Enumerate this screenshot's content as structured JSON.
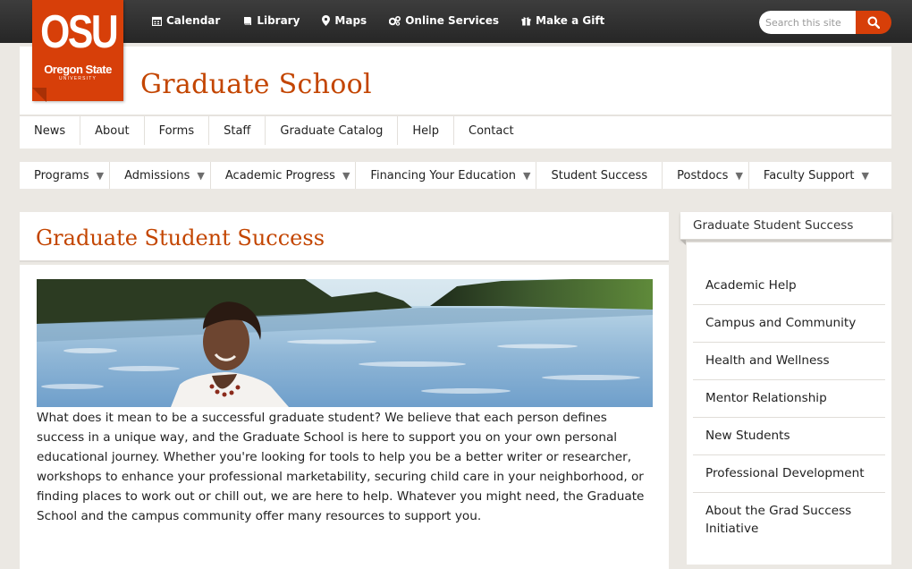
{
  "logo": {
    "mark": "OSU",
    "name": "Oregon State",
    "sub": "UNIVERSITY"
  },
  "topnav": [
    {
      "label": "Calendar",
      "icon": "calendar-icon"
    },
    {
      "label": "Library",
      "icon": "book-icon"
    },
    {
      "label": "Maps",
      "icon": "map-marker-icon"
    },
    {
      "label": "Online Services",
      "icon": "gears-icon"
    },
    {
      "label": "Make a Gift",
      "icon": "gift-icon"
    }
  ],
  "search": {
    "placeholder": "Search this site",
    "value": ""
  },
  "site": {
    "title": "Graduate School"
  },
  "menu_primary": [
    "News",
    "About",
    "Forms",
    "Staff",
    "Graduate Catalog",
    "Help",
    "Contact"
  ],
  "menu_secondary": [
    {
      "label": "Programs",
      "dropdown": true
    },
    {
      "label": "Admissions",
      "dropdown": true
    },
    {
      "label": "Academic Progress",
      "dropdown": true
    },
    {
      "label": "Financing Your Education",
      "dropdown": true
    },
    {
      "label": "Student Success",
      "dropdown": false
    },
    {
      "label": "Postdocs",
      "dropdown": true
    },
    {
      "label": "Faculty Support",
      "dropdown": true
    }
  ],
  "dropdown_glyph": "▼",
  "page": {
    "title": "Graduate Student Success",
    "intro": "What does it mean to be a successful graduate student? We believe that each person defines success in a unique way, and the Graduate School is here to support you on your own personal educational journey. Whether you're looking for tools to help you be a better writer or researcher, workshops to enhance your professional marketability, securing child care in your neighborhood, or finding places to work out or chill out, we are here to help. Whatever you might need, the Graduate School and the campus community offer many resources to support you."
  },
  "sidebar": {
    "heading": "Graduate Student Success",
    "items": [
      "Academic Help",
      "Campus and Community",
      "Health and Wellness",
      "Mentor Relationship",
      "New Students",
      "Professional Development",
      "About the Grad Success Initiative"
    ]
  },
  "colors": {
    "brand": "#d73f09",
    "title": "#c34500",
    "topbar": "#2e2e2e",
    "page_bg": "#ebe8e3"
  }
}
